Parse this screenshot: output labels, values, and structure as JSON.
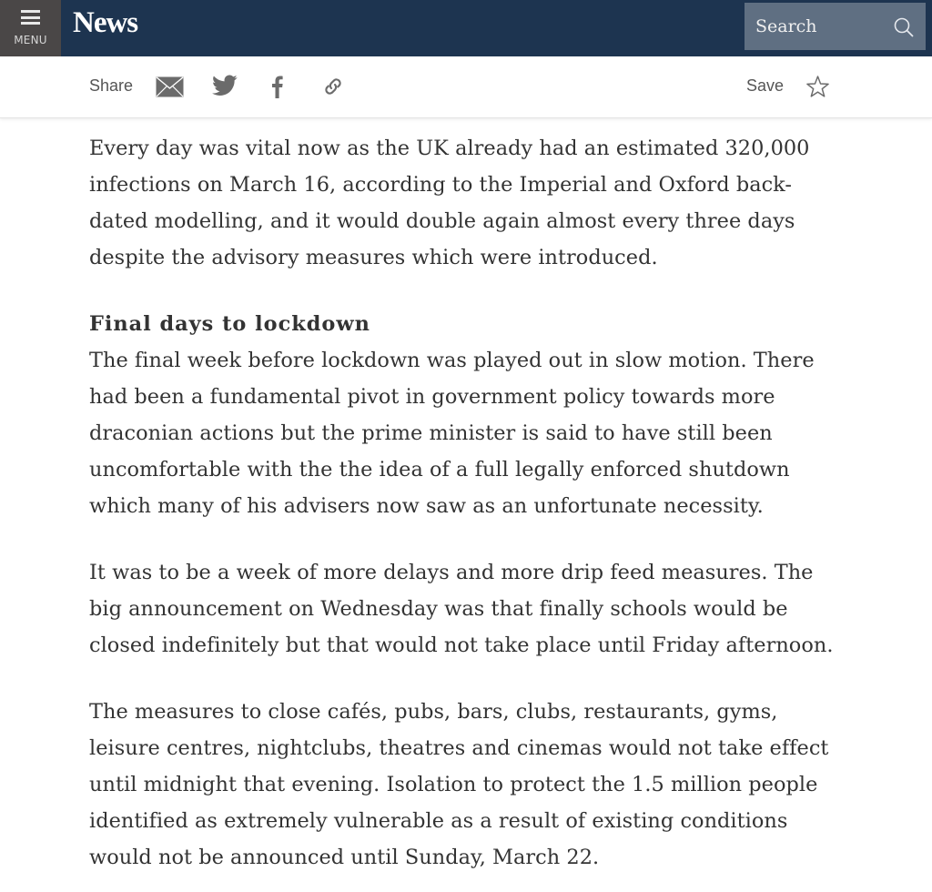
{
  "header": {
    "menu_label": "MENU",
    "brand": "News",
    "search_placeholder": "Search"
  },
  "sharebar": {
    "share_label": "Share",
    "share_icons": [
      "mail-icon",
      "twitter-icon",
      "facebook-icon",
      "link-icon"
    ],
    "save_label": "Save",
    "save_icon": "star-icon"
  },
  "colors": {
    "topbar": "#1d3450",
    "menu_bg": "#4a4747",
    "search_bg": "#5f6f82",
    "text": "#333333",
    "icon": "#6b6b6b"
  },
  "article": {
    "para1": "Every day was vital now as the UK already had an estimated 320,000 infections on March 16, according to the Imperial and Oxford back-dated modelling, and it would double again almost every three days despite the advisory measures which were introduced.",
    "heading": "Final days to lockdown",
    "para2": "The final week before lockdown was played out in slow motion. There had been a fundamental pivot in government policy towards more draconian actions but the prime minister is said to have still been uncomfortable with the the idea of a full legally enforced shutdown which many of his advisers now saw as an unfortunate necessity.",
    "para3": "It was to be a week of more delays and more drip feed measures. The big announcement on Wednesday was that finally schools would be closed indefinitely but that would not take place until Friday afternoon.",
    "para4": "The measures to close cafés, pubs, bars, clubs, restaurants, gyms, leisure centres, nightclubs, theatres and cinemas would not take effect until midnight that evening. Isolation to protect the 1.5 million people identified as extremely vulnerable as a result of existing conditions would not be announced until Sunday, March 22."
  }
}
